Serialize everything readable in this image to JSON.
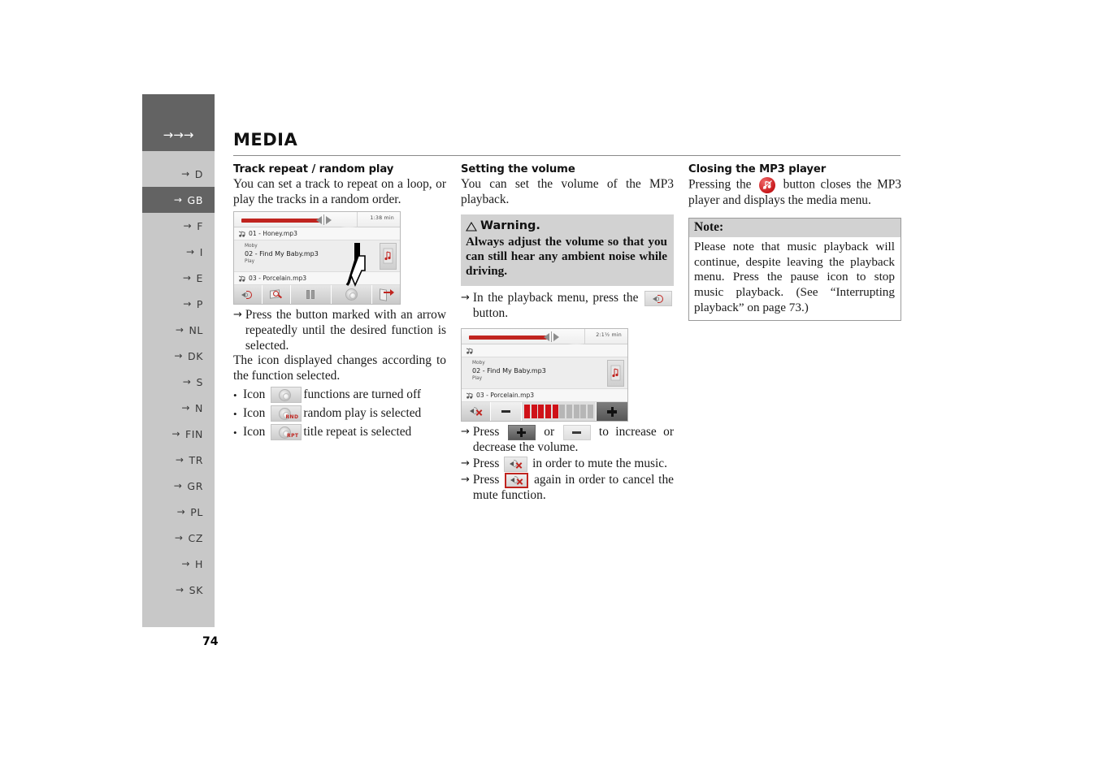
{
  "page": {
    "number": "74",
    "header_title": "MEDIA",
    "nav_arrows": "→→→"
  },
  "sidebar": {
    "items": [
      {
        "code": "D",
        "active": false
      },
      {
        "code": "GB",
        "active": true
      },
      {
        "code": "F",
        "active": false
      },
      {
        "code": "I",
        "active": false
      },
      {
        "code": "E",
        "active": false
      },
      {
        "code": "P",
        "active": false
      },
      {
        "code": "NL",
        "active": false
      },
      {
        "code": "DK",
        "active": false
      },
      {
        "code": "S",
        "active": false
      },
      {
        "code": "N",
        "active": false
      },
      {
        "code": "FIN",
        "active": false
      },
      {
        "code": "TR",
        "active": false
      },
      {
        "code": "GR",
        "active": false
      },
      {
        "code": "PL",
        "active": false
      },
      {
        "code": "CZ",
        "active": false
      },
      {
        "code": "H",
        "active": false
      },
      {
        "code": "SK",
        "active": false
      }
    ]
  },
  "col1": {
    "heading": "Track repeat / random play",
    "intro": "You can set a track to repeat on a loop, or play the tracks in a random order.",
    "step1_arrow": "→",
    "step1": "Press the button marked with an arrow repeatedly until the desired function is selected.",
    "after": "The icon displayed changes according to the function selected.",
    "bullets": [
      {
        "dot": "•",
        "label": "Icon",
        "tag": "",
        "text": "functions are turned off"
      },
      {
        "dot": "•",
        "label": "Icon",
        "tag": "RND",
        "text": "random play is selected"
      },
      {
        "dot": "•",
        "label": "Icon",
        "tag": "RPT",
        "text": "title repeat is selected"
      }
    ],
    "device": {
      "time": "1:38 min",
      "track_above": "01 - Honey.mp3",
      "artist": "Moby",
      "track_current": "02 - Find My Baby.mp3",
      "status": "Play",
      "track_below": "03 - Porcelain.mp3",
      "toolbar_icons": [
        "speaker-icon",
        "browse-icon",
        "pause-icon",
        "repeat-mode-icon",
        "exit-icon"
      ]
    }
  },
  "col2": {
    "heading": "Setting the volume",
    "intro": "You can set the volume of the MP3 playback.",
    "warning_title": "Warning.",
    "warning_body": "Always adjust the volume so that you can still hear any ambient noise while driving.",
    "step1_arrow": "→",
    "step1_a": "In the playback menu, press the",
    "step1_b": "button.",
    "device": {
      "time": "2:1½ min",
      "artist": "Moby",
      "track_current": "02 - Find My Baby.mp3",
      "status": "Play",
      "track_below": "03 - Porcelain.mp3",
      "volume_segments_total": 10,
      "volume_segments_on": 5,
      "mute_label": "mute-icon",
      "minus_label": "−",
      "plus_label": "+"
    },
    "step2_arrow": "→",
    "step2_a": "Press",
    "step2_b": "or",
    "step2_c": "to increase or decrease the volume.",
    "step3_arrow": "→",
    "step3_a": "Press",
    "step3_b": "in order to mute the music.",
    "step4_arrow": "→",
    "step4_a": "Press",
    "step4_b": "again in order to cancel the mute function."
  },
  "col3": {
    "heading": "Closing the MP3 player",
    "intro_a": "Pressing the",
    "intro_b": "button closes the MP3 player and displays the media menu.",
    "note_title": "Note:",
    "note_body": "Please note that music playback will continue, despite leaving the playback menu. Press the pause icon to stop music playback. (See “Interrupting playback” on page 73.)"
  },
  "colors": {
    "sidebar_bg": "#c8c8c8",
    "sidebar_active": "#636363",
    "accent_red": "#c0241f",
    "box_gray": "#d2d2d2"
  }
}
